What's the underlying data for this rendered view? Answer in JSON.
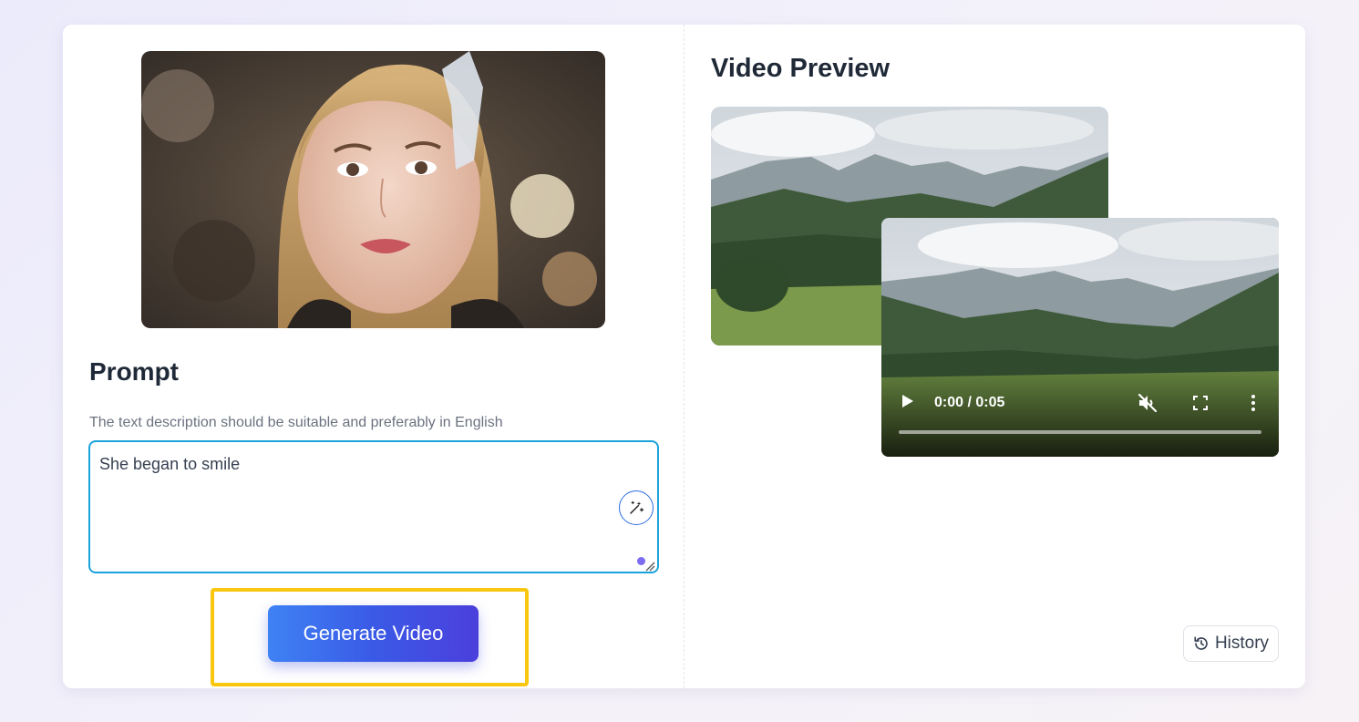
{
  "left_panel": {
    "image_alt": "Portrait of young woman with blonde hair and white ribbon",
    "prompt_title": "Prompt",
    "prompt_hint": "The text description should be suitable and preferably in English",
    "prompt_value": "She began to smile",
    "enhance_icon": "magic-wand-icon",
    "generate_label": "Generate Video",
    "highlight_color": "#f9c710"
  },
  "right_panel": {
    "preview_title": "Video Preview",
    "player": {
      "time": "0:00 / 0:05",
      "muted": true,
      "progress": 0
    },
    "history_label": "History",
    "history_icon": "history-icon"
  },
  "colors": {
    "accent_blue": "#1aa3dc",
    "button_gradient_start": "#3f82f4",
    "button_gradient_end": "#4b3fdc"
  }
}
